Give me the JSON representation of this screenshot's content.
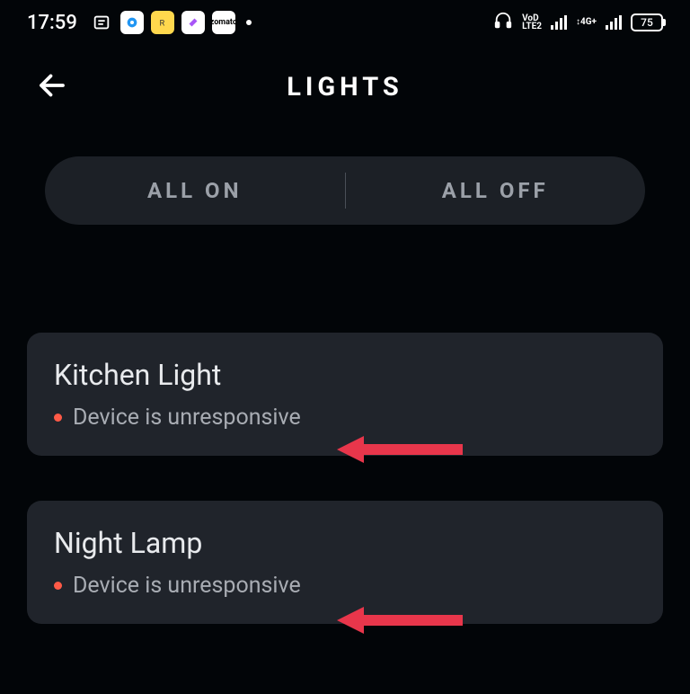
{
  "statusBar": {
    "time": "17:59",
    "batteryLevel": "75",
    "networkLabels": {
      "volte": "VoLTE2",
      "4g": "4G+"
    }
  },
  "header": {
    "title": "LIGHTS"
  },
  "toggle": {
    "allOn": "ALL ON",
    "allOff": "ALL OFF"
  },
  "devices": [
    {
      "name": "Kitchen Light",
      "status": "Device is unresponsive"
    },
    {
      "name": "Night Lamp",
      "status": "Device is unresponsive"
    }
  ]
}
